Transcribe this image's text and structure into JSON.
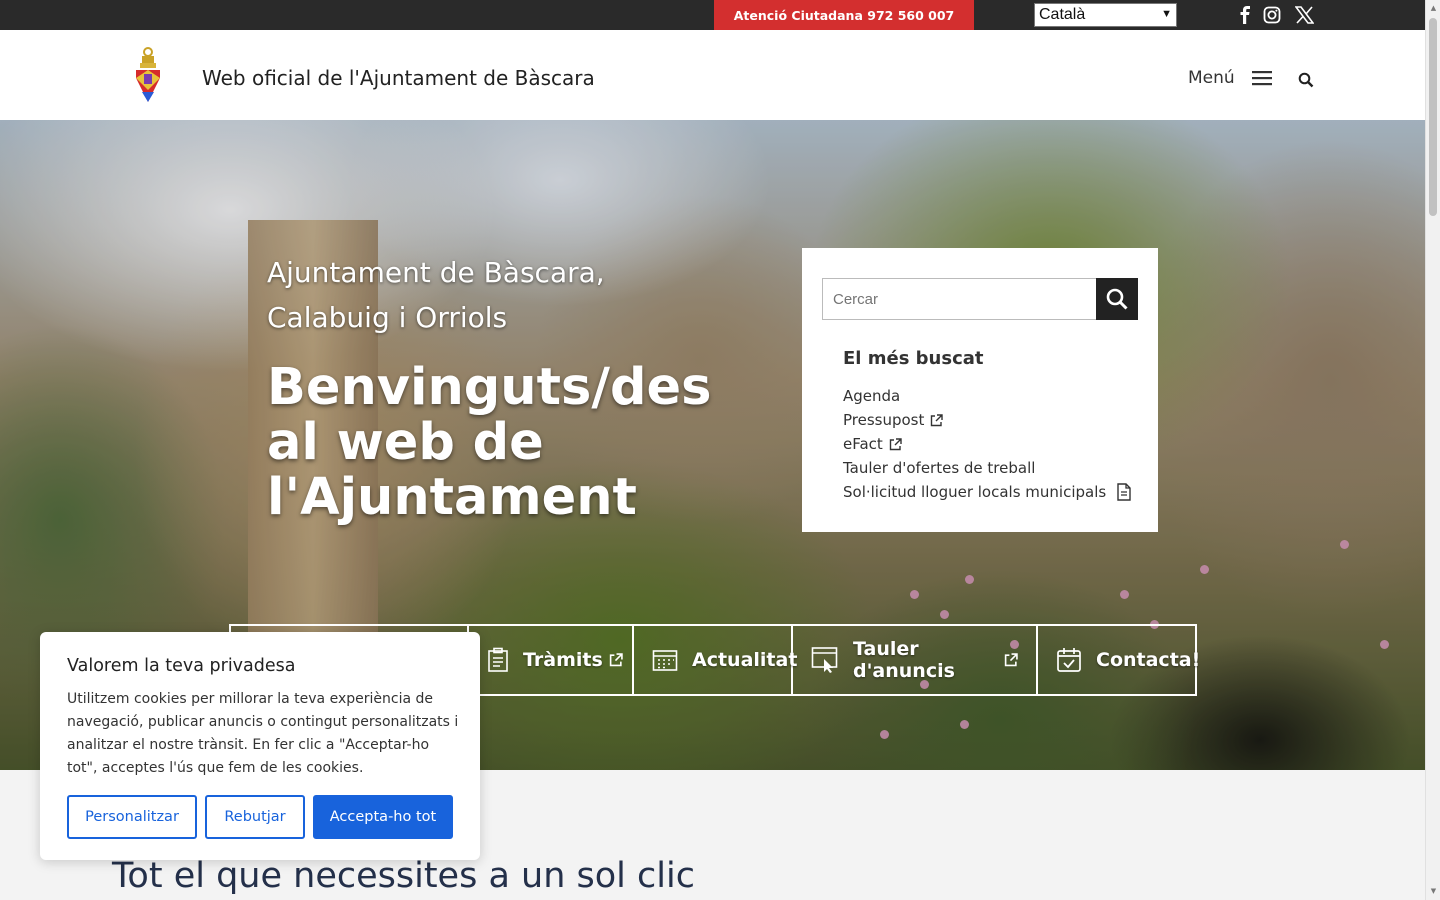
{
  "topbar": {
    "atencio_label": "Atenció Ciutadana 972 560 007",
    "language_selected": "Català",
    "social": [
      "facebook-icon",
      "instagram-icon",
      "x-icon"
    ]
  },
  "header": {
    "site_title": "Web oficial de l'Ajuntament de Bàscara",
    "menu_label": "Menú"
  },
  "hero": {
    "subtitle": "Ajuntament de Bàscara, Calabuig i Orriols",
    "welcome": "Benvinguts/des al web de l'Ajuntament"
  },
  "search": {
    "placeholder": "Cercar",
    "heading": "El més buscat",
    "links": [
      {
        "label": "Agenda",
        "icon": ""
      },
      {
        "label": "Pressupost",
        "icon": "external-link-icon"
      },
      {
        "label": "eFact",
        "icon": "external-link-icon"
      },
      {
        "label": "Tauler d'ofertes de treball",
        "icon": ""
      },
      {
        "label": "Sol·licitud lloguer locals municipals",
        "icon": "document-icon"
      }
    ]
  },
  "quicknav": {
    "tramits": "Tràmits",
    "actualitat": "Actualitat",
    "tauler": "Tauler d'anuncis",
    "contacta": "Contacta!"
  },
  "lower": {
    "title": "Tot el que necessites a un sol clic"
  },
  "cookie": {
    "title": "Valorem la teva privadesa",
    "text": "Utilitzem cookies per millorar la teva experiència de navegació, publicar anuncis o contingut personalitzats i analitzar el nostre trànsit. En fer clic a \"Acceptar-ho tot\", acceptes l'ús que fem de les cookies.",
    "btn_customize": "Personalitzar",
    "btn_reject": "Rebutjar",
    "btn_accept": "Accepta-ho tot"
  },
  "colors": {
    "atencio_bg": "#d32f2f",
    "topbar_bg": "#2a2a2a",
    "cookie_accent": "#1863dc",
    "title_navy": "#24304a"
  }
}
